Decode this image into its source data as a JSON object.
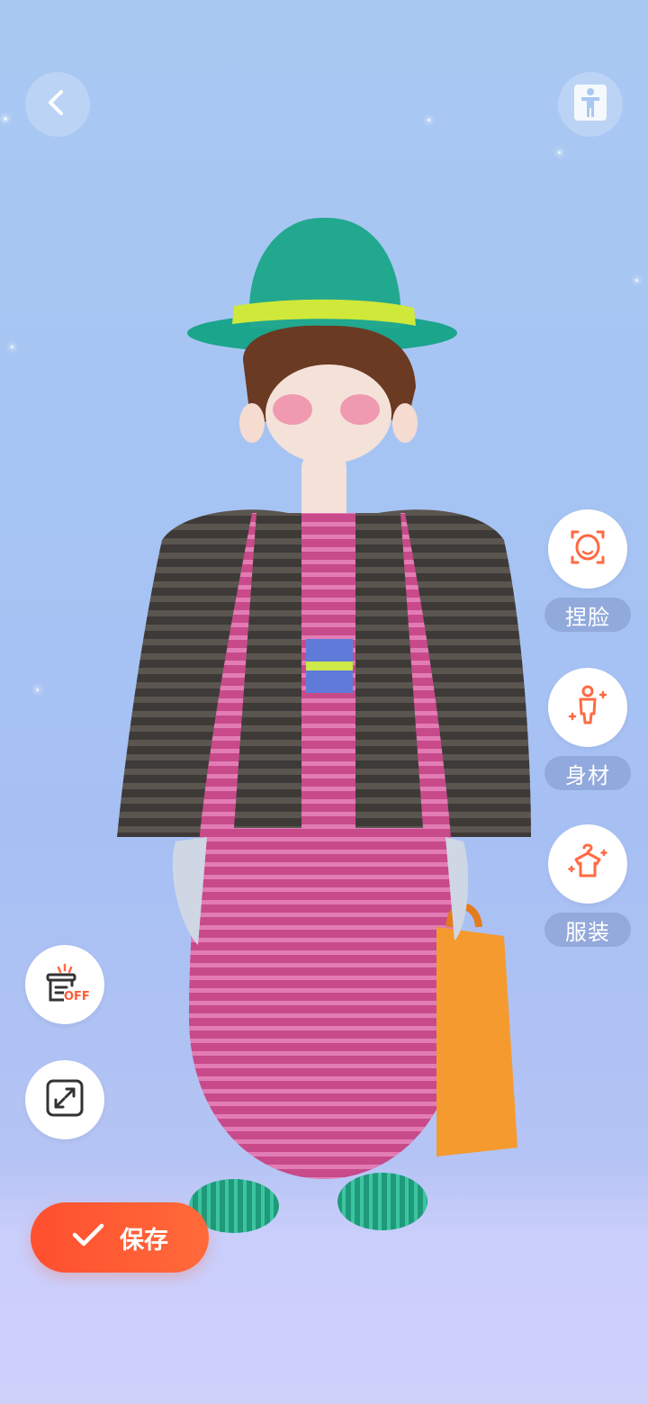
{
  "top_bar": {
    "back_icon": "chevron-left-icon",
    "body_toggle_icon": "person-standing-icon"
  },
  "side_menu": {
    "items": [
      {
        "label": "捏脸",
        "icon": "face-edit-icon"
      },
      {
        "label": "身材",
        "icon": "body-shape-icon"
      },
      {
        "label": "服装",
        "icon": "clothes-hanger-icon"
      }
    ]
  },
  "left_tools": {
    "furniture_toggle_badge": "OFF",
    "furniture_toggle_icon": "stage-off-icon",
    "fullscreen_icon": "expand-icon"
  },
  "save_button": {
    "label": "保存",
    "icon": "check-icon"
  },
  "colors": {
    "accent": "#ff5a36",
    "icon_orange": "#ff6a43",
    "background": "#a9c8f2"
  }
}
